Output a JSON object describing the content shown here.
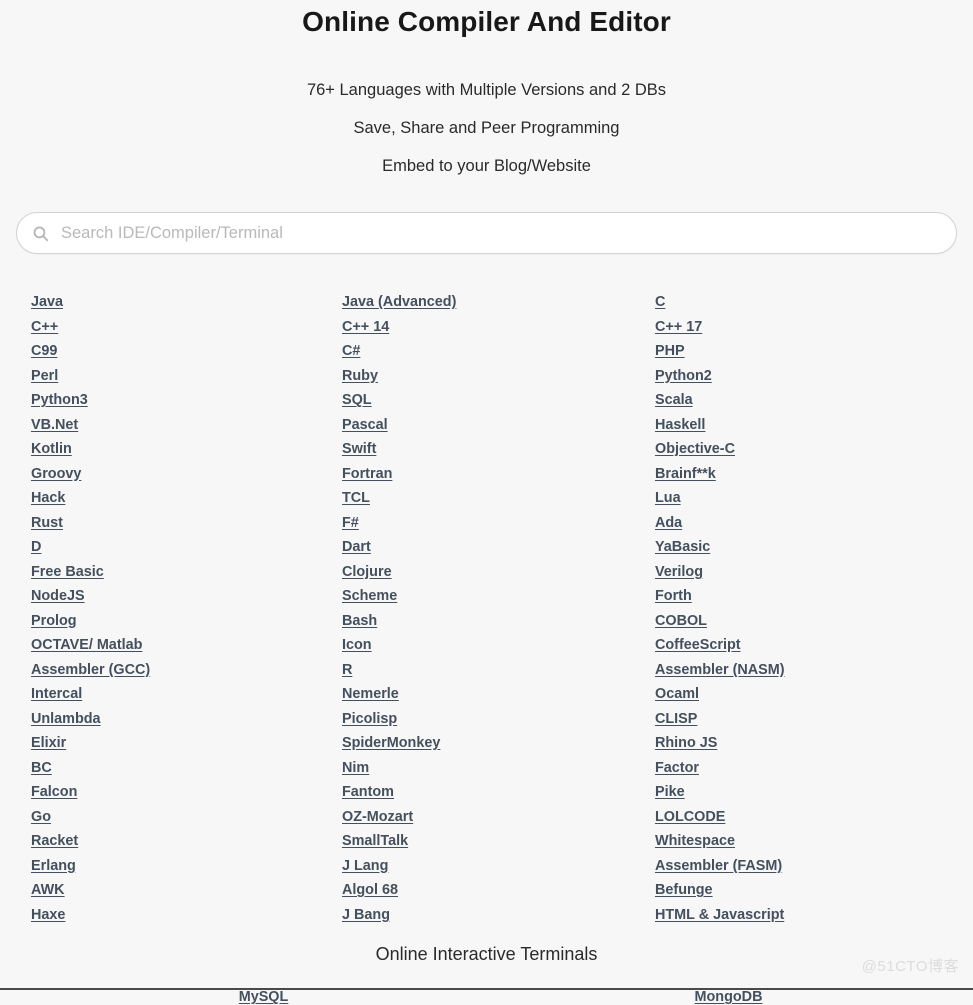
{
  "page": {
    "background_color": "#f7f7f7",
    "link_color": "#44505e",
    "title_color": "#181818"
  },
  "hero": {
    "title": "Online Compiler And Editor",
    "sub1": "76+ Languages with Multiple Versions and 2 DBs",
    "sub2": "Save, Share and Peer Programming",
    "sub3": "Embed to your Blog/Website"
  },
  "search": {
    "icon": "search-icon",
    "value": "",
    "placeholder": "Search IDE/Compiler/Terminal"
  },
  "languages": {
    "column1": [
      "Java",
      "C++",
      "C99",
      "Perl",
      "Python3",
      "VB.Net",
      "Kotlin",
      "Groovy",
      "Hack",
      "Rust",
      "D",
      "Free Basic",
      "NodeJS",
      "Prolog",
      "OCTAVE/ Matlab",
      "Assembler (GCC)",
      "Intercal",
      "Unlambda",
      "Elixir",
      "BC",
      "Falcon",
      "Go",
      "Racket",
      "Erlang",
      "AWK",
      "Haxe"
    ],
    "column2": [
      "Java (Advanced)",
      "C++ 14",
      "C#",
      "Ruby",
      "SQL",
      "Pascal",
      "Swift",
      "Fortran",
      "TCL",
      "F#",
      "Dart",
      "Clojure",
      "Scheme",
      "Bash",
      "Icon",
      "R",
      "Nemerle",
      "Picolisp",
      "SpiderMonkey",
      "Nim",
      "Fantom",
      "OZ-Mozart",
      "SmallTalk",
      "J Lang",
      "Algol 68",
      "J Bang"
    ],
    "column3": [
      "C",
      "C++ 17",
      "PHP",
      "Python2",
      "Scala",
      "Haskell",
      "Objective-C",
      "Brainf**k",
      "Lua",
      "Ada",
      "YaBasic",
      "Verilog",
      "Forth",
      "COBOL",
      "CoffeeScript",
      "Assembler (NASM)",
      "Ocaml",
      "CLISP",
      "Rhino JS",
      "Factor",
      "Pike",
      "LOLCODE",
      "Whitespace",
      "Assembler (FASM)",
      "Befunge",
      "HTML & Javascript"
    ]
  },
  "terminals": {
    "heading": "Online Interactive Terminals",
    "databases": [
      "MySQL",
      "MongoDB"
    ]
  },
  "watermark": {
    "text": "@51CTO博客"
  }
}
